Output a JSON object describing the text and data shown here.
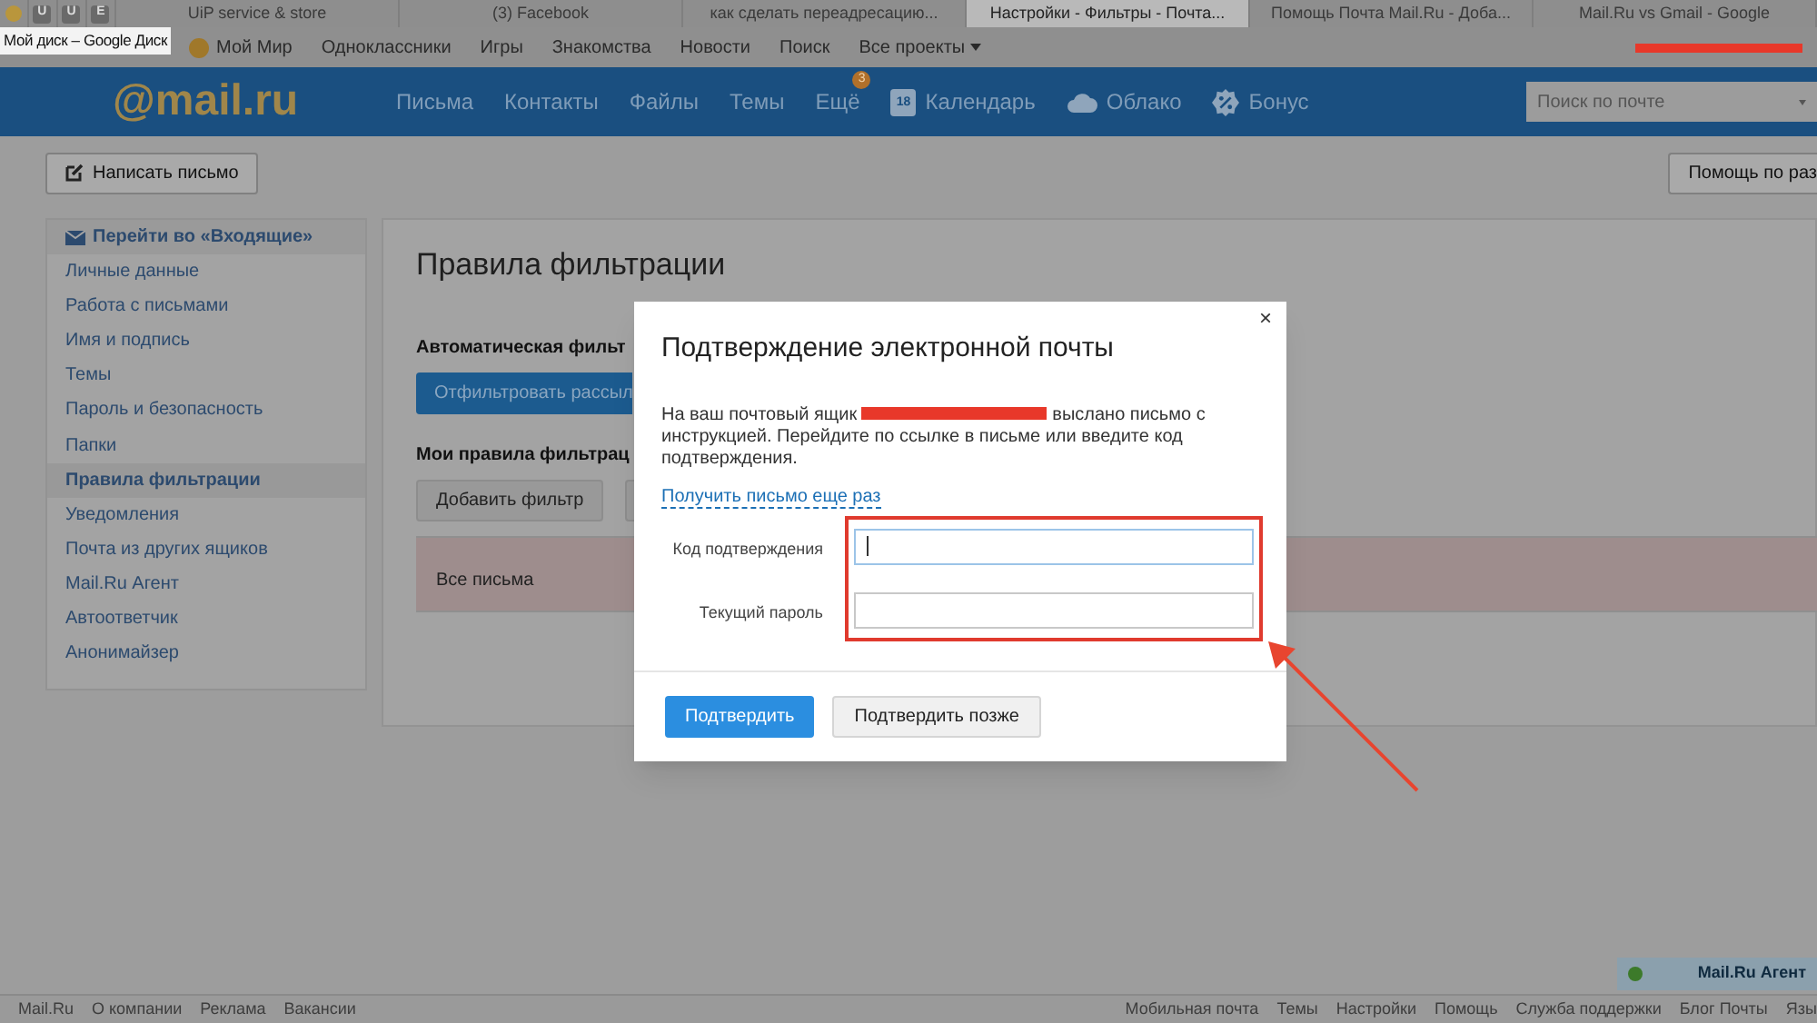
{
  "browser_tabs": [
    {
      "kind": "favicon",
      "selected": false
    },
    {
      "kind": "pinned",
      "label": "U",
      "selected": false
    },
    {
      "kind": "pinned",
      "label": "U",
      "selected": false
    },
    {
      "kind": "pinned",
      "label": "E",
      "selected": false
    },
    {
      "kind": "page",
      "label": "UiP service & store",
      "selected": false
    },
    {
      "kind": "page",
      "label": "(3) Facebook",
      "selected": false
    },
    {
      "kind": "page",
      "label": "как сделать переадресацию...",
      "selected": false
    },
    {
      "kind": "page",
      "label": "Настройки - Фильтры - Почта...",
      "selected": true
    },
    {
      "kind": "page",
      "label": "Помощь Почта Mail.Ru - Доба...",
      "selected": false
    },
    {
      "kind": "page",
      "label": "Mail.Ru vs Gmail - Google",
      "selected": false
    }
  ],
  "tooltip": "Мой диск – Google Диск",
  "portal_links": [
    "Мой Мир",
    "Одноклассники",
    "Игры",
    "Знакомства",
    "Новости",
    "Поиск",
    "Все проекты"
  ],
  "header": {
    "logo": "@mail.ru",
    "nav": [
      {
        "kind": "text",
        "label": "Письма"
      },
      {
        "kind": "text",
        "label": "Контакты"
      },
      {
        "kind": "text",
        "label": "Файлы"
      },
      {
        "kind": "text",
        "label": "Темы"
      },
      {
        "kind": "badge",
        "label": "Ещё",
        "badge": "3"
      },
      {
        "kind": "calendar",
        "label": "Календарь",
        "badge": "18"
      },
      {
        "kind": "cloud",
        "label": "Облако"
      },
      {
        "kind": "bonus",
        "label": "Бонус"
      }
    ],
    "search": {
      "placeholder": "Поиск по почте"
    }
  },
  "toolbar": {
    "compose": "Написать письмо",
    "help": "Помощь по раз"
  },
  "sidebar": {
    "inbox_link": "Перейти во «Входящие»",
    "items": [
      {
        "label": "Личные данные",
        "selected": false
      },
      {
        "label": "Работа с письмами",
        "selected": false
      },
      {
        "label": "Имя и подпись",
        "selected": false
      },
      {
        "label": "Темы",
        "selected": false
      },
      {
        "label": "Пароль и безопасность",
        "selected": false
      },
      {
        "label": "Папки",
        "selected": false
      },
      {
        "label": "Правила фильтрации",
        "selected": true
      },
      {
        "label": "Уведомления",
        "selected": false
      },
      {
        "label": "Почта из других ящиков",
        "selected": false
      },
      {
        "label": "Mail.Ru Агент",
        "selected": false
      },
      {
        "label": "Автоответчик",
        "selected": false
      },
      {
        "label": "Анонимайзер",
        "selected": false
      }
    ]
  },
  "content": {
    "title": "Правила фильтрации",
    "auto_heading": "Автоматическая фильт",
    "auto_button": "Отфильтровать рассыл",
    "my_heading": "Мои правила фильтрац",
    "add_button": "Добавить фильтр",
    "rule_row": "Все письма"
  },
  "modal": {
    "title": "Подтверждение электронной почты",
    "close": "×",
    "message_before": "На ваш почтовый ящик",
    "message_after": "выслано письмо с инструкцией. Перейдите по ссылке в письме или введите код подтверждения.",
    "resend_link": "Получить письмо еще раз",
    "fields": [
      {
        "label": "Код подтверждения",
        "focused": true
      },
      {
        "label": "Текущий пароль",
        "focused": false
      }
    ],
    "buttons": [
      {
        "kind": "primary",
        "label": "Подтвердить"
      },
      {
        "kind": "secondary",
        "label": "Подтвердить позже"
      }
    ]
  },
  "footer": {
    "left": [
      "Mail.Ru",
      "О компании",
      "Реклама",
      "Вакансии"
    ],
    "right": [
      "Мобильная почта",
      "Темы",
      "Настройки",
      "Помощь",
      "Служба поддержки",
      "Блог Почты",
      "Язы"
    ]
  },
  "agent": "Mail.Ru Агент"
}
